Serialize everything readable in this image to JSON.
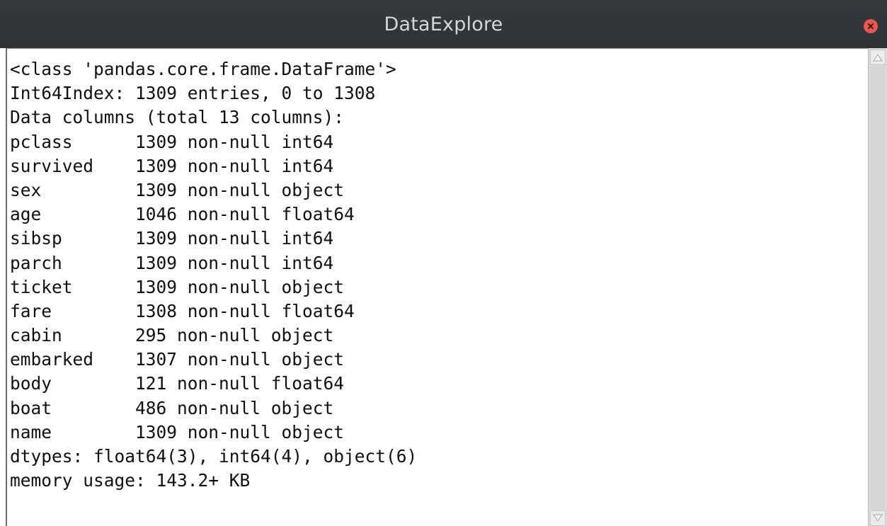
{
  "window": {
    "title": "DataExplore",
    "close_icon": "close-icon"
  },
  "console": {
    "lines": [
      "<class 'pandas.core.frame.DataFrame'>",
      "Int64Index: 1309 entries, 0 to 1308",
      "Data columns (total 13 columns):",
      "pclass      1309 non-null int64",
      "survived    1309 non-null int64",
      "sex         1309 non-null object",
      "age         1046 non-null float64",
      "sibsp       1309 non-null int64",
      "parch       1309 non-null int64",
      "ticket      1309 non-null object",
      "fare        1308 non-null float64",
      "cabin       295 non-null object",
      "embarked    1307 non-null object",
      "body        121 non-null float64",
      "boat        486 non-null object",
      "name        1309 non-null object",
      "dtypes: float64(3), int64(4), object(6)",
      "memory usage: 143.2+ KB"
    ]
  },
  "scrollbar": {
    "up_icon": "scroll-up-arrow-icon",
    "down_icon": "scroll-down-arrow-icon"
  },
  "colors": {
    "titlebar": "#2f3338",
    "title_text": "#d3d7da",
    "close_button": "#e8574e"
  }
}
